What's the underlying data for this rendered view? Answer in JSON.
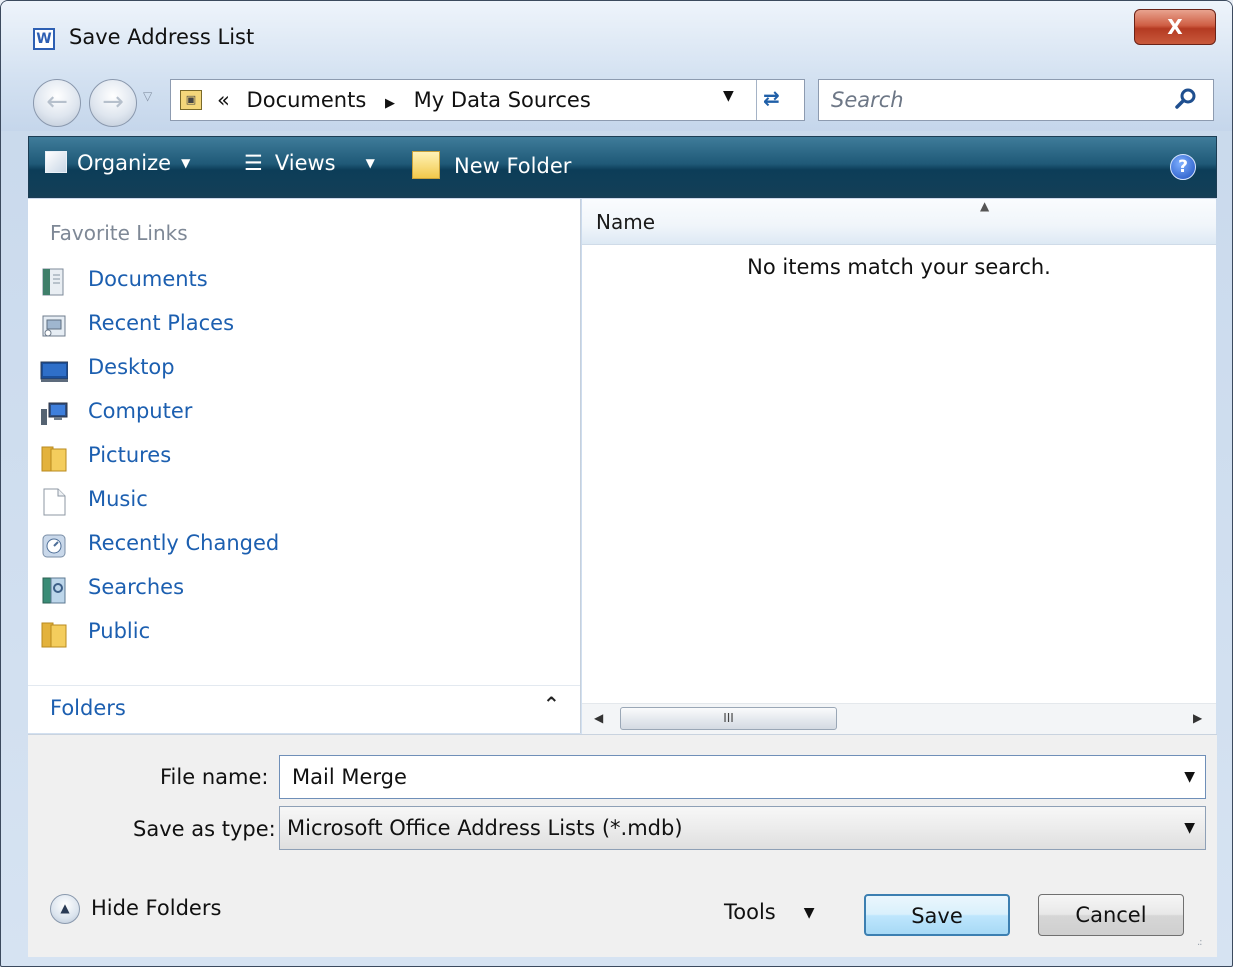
{
  "window": {
    "title": "Save Address List",
    "app_icon": "word-icon",
    "close_label": "X"
  },
  "navigation": {
    "breadcrumb_overflow": "«",
    "breadcrumb": [
      "Documents",
      "My Data Sources"
    ],
    "search_placeholder": "Search"
  },
  "toolbar": {
    "organize": "Organize",
    "views": "Views",
    "new_folder": "New Folder",
    "help": "?"
  },
  "sidebar": {
    "heading": "Favorite Links",
    "items": [
      {
        "label": "Documents",
        "icon": "documents-icon"
      },
      {
        "label": "Recent Places",
        "icon": "recent-places-icon"
      },
      {
        "label": "Desktop",
        "icon": "desktop-icon"
      },
      {
        "label": "Computer",
        "icon": "computer-icon"
      },
      {
        "label": "Pictures",
        "icon": "folder-icon"
      },
      {
        "label": "Music",
        "icon": "file-icon"
      },
      {
        "label": "Recently Changed",
        "icon": "recently-changed-icon"
      },
      {
        "label": "Searches",
        "icon": "searches-icon"
      },
      {
        "label": "Public",
        "icon": "folder-icon"
      }
    ],
    "folders_label": "Folders"
  },
  "file_list": {
    "columns": [
      "Name"
    ],
    "empty_message": "No items match your search.",
    "scroll_thumb": "III"
  },
  "form": {
    "file_name_label": "File name:",
    "file_name_value": "Mail Merge",
    "save_type_label": "Save as type:",
    "save_type_value": "Microsoft Office Address Lists (*.mdb)"
  },
  "footer": {
    "hide_folders": "Hide Folders",
    "tools": "Tools",
    "save": "Save",
    "cancel": "Cancel"
  },
  "colors": {
    "link": "#1c5fb0",
    "toolbar_dark": "#0c3d58",
    "close_red": "#c0452a"
  }
}
